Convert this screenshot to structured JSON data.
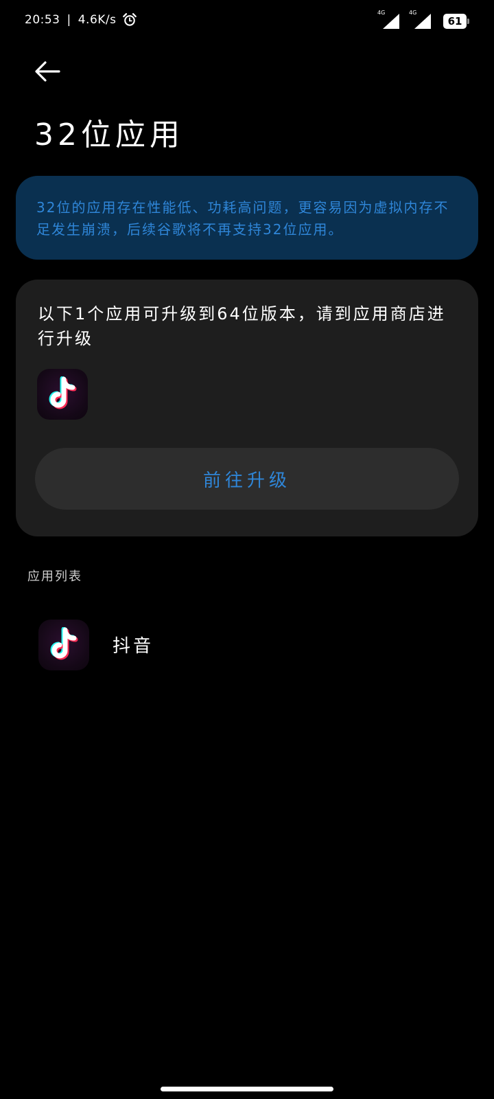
{
  "status_bar": {
    "time": "20:53",
    "separator": "|",
    "net_speed": "4.6K/s",
    "sim1_type": "4G",
    "sim2_type": "4G",
    "battery": "61"
  },
  "header": {
    "title": "32位应用"
  },
  "notice": {
    "text": "32位的应用存在性能低、功耗高问题，更容易因为虚拟内存不足发生崩溃，后续谷歌将不再支持32位应用。"
  },
  "upgrade_card": {
    "text": "以下1个应用可升级到64位版本，请到应用商店进行升级",
    "button_label": "前往升级"
  },
  "app_list": {
    "section_label": "应用列表",
    "items": [
      {
        "name": "抖音",
        "icon": "tiktok-icon"
      }
    ]
  },
  "colors": {
    "background": "#000000",
    "notice_bg": "#0a3050",
    "accent_blue": "#2f86d8",
    "card_bg": "#1e1e1e",
    "button_bg": "#2d2d2d"
  }
}
